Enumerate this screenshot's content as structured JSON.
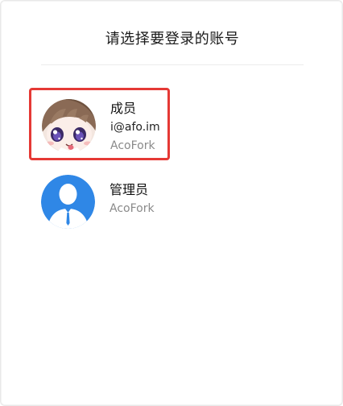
{
  "dialog": {
    "title": "请选择要登录的账号"
  },
  "accounts": [
    {
      "name": "成员",
      "email": "i@afo.im",
      "org": "AcoFork",
      "selected": true,
      "avatar_icon": "anime-girl-avatar"
    },
    {
      "name": "管理员",
      "org": "AcoFork",
      "selected": false,
      "avatar_icon": "default-user-avatar"
    }
  ],
  "colors": {
    "selection_border": "#e53935",
    "default_avatar_bg": "#2f87e6",
    "muted_text": "#8a8a8a"
  }
}
